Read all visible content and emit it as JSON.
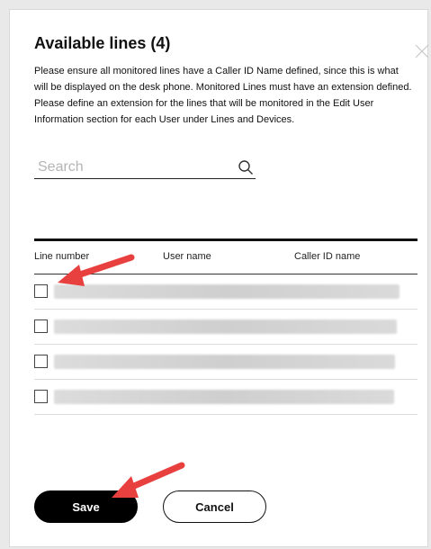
{
  "dialog": {
    "title": "Available lines (4)",
    "description": "Please ensure all monitored lines have a Caller ID Name defined, since this is what will be displayed on the desk phone. Monitored Lines must have an extension defined. Please define an extension for the lines that will be monitored in the Edit User Information section for each User under Lines and Devices.",
    "close_icon": "close-icon"
  },
  "search": {
    "placeholder": "Search",
    "value": "",
    "icon": "search-icon"
  },
  "table": {
    "columns": [
      "Line number",
      "User name",
      "Caller ID name"
    ],
    "rows": [
      {
        "checked": false,
        "content": "redacted"
      },
      {
        "checked": false,
        "content": "redacted"
      },
      {
        "checked": false,
        "content": "redacted"
      },
      {
        "checked": false,
        "content": "redacted"
      }
    ]
  },
  "buttons": {
    "save_label": "Save",
    "cancel_label": "Cancel"
  },
  "annotations": {
    "arrow_color": "#e8403f"
  },
  "colors": {
    "primary": "#000000",
    "background": "#ffffff"
  }
}
